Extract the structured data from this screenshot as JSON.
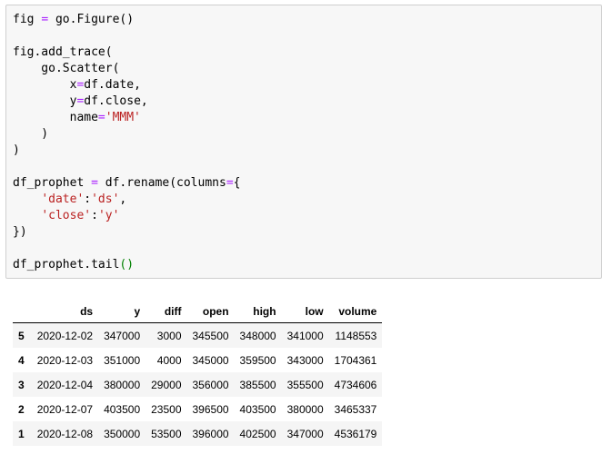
{
  "code_cell": {
    "tokens": {
      "l1_a": "fig ",
      "l1_eq": "=",
      "l1_b": " go.Figure()",
      "l3": "fig.add_trace(",
      "l4": "    go.Scatter(",
      "l5_a": "        x",
      "l5_eq": "=",
      "l5_b": "df.date,",
      "l6_a": "        y",
      "l6_eq": "=",
      "l6_b": "df.close,",
      "l7_a": "        name",
      "l7_eq": "=",
      "l7_s": "'MMM'",
      "l8": "    )",
      "l9": ")",
      "l11_a": "df_prophet ",
      "l11_eq": "=",
      "l11_b": " df.rename(columns",
      "l11_eq2": "=",
      "l11_c": "{",
      "l12_ind": "    ",
      "l12_s1": "'date'",
      "l12_colon": ":",
      "l12_s2": "'ds'",
      "l12_comma": ",",
      "l13_ind": "    ",
      "l13_s1": "'close'",
      "l13_colon": ":",
      "l13_s2": "'y'",
      "l14": "})",
      "l16_a": "df_prophet.tail",
      "l16_p": "()"
    }
  },
  "dataframe": {
    "columns": [
      "",
      "ds",
      "y",
      "diff",
      "open",
      "high",
      "low",
      "volume"
    ],
    "rows": [
      [
        "5",
        "2020-12-02",
        "347000",
        "3000",
        "345500",
        "348000",
        "341000",
        "1148553"
      ],
      [
        "4",
        "2020-12-03",
        "351000",
        "4000",
        "345000",
        "359500",
        "343000",
        "1704361"
      ],
      [
        "3",
        "2020-12-04",
        "380000",
        "29000",
        "356000",
        "385500",
        "355500",
        "4734606"
      ],
      [
        "2",
        "2020-12-07",
        "403500",
        "23500",
        "396500",
        "403500",
        "380000",
        "3465337"
      ],
      [
        "1",
        "2020-12-08",
        "350000",
        "53500",
        "396000",
        "402500",
        "347000",
        "4536179"
      ]
    ]
  }
}
